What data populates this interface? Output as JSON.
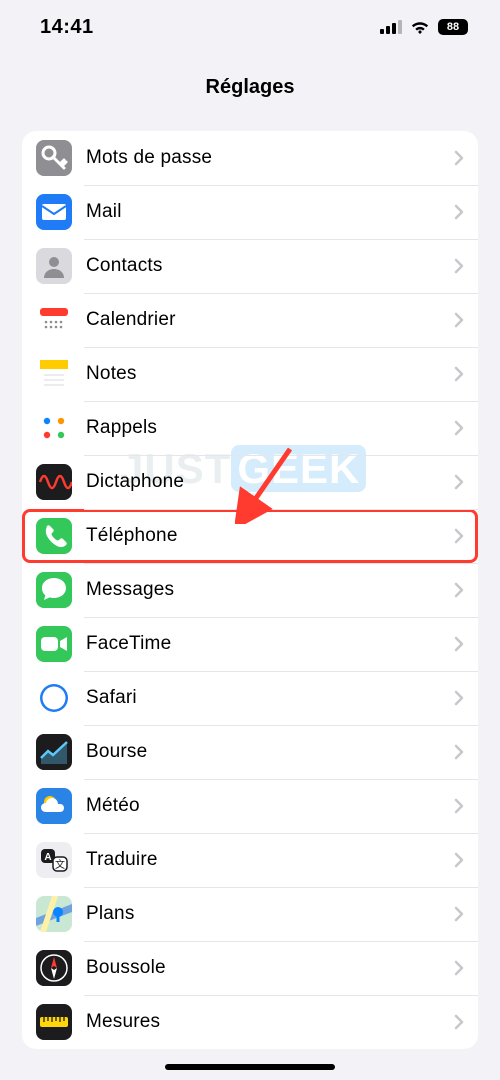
{
  "status": {
    "time": "14:41",
    "battery": "88"
  },
  "header": {
    "title": "Réglages"
  },
  "rows": [
    {
      "id": "passwords",
      "label": "Mots de passe",
      "icon": "key",
      "bg": "#8e8e93",
      "highlight": false
    },
    {
      "id": "mail",
      "label": "Mail",
      "icon": "mail",
      "bg": "#1f7cf6",
      "highlight": false
    },
    {
      "id": "contacts",
      "label": "Contacts",
      "icon": "contacts",
      "bg": "#d9d9de",
      "highlight": false
    },
    {
      "id": "calendar",
      "label": "Calendrier",
      "icon": "calendar",
      "bg": "#ffffff",
      "highlight": false
    },
    {
      "id": "notes",
      "label": "Notes",
      "icon": "notes",
      "bg": "#ffffff",
      "highlight": false
    },
    {
      "id": "reminders",
      "label": "Rappels",
      "icon": "reminders",
      "bg": "#ffffff",
      "highlight": false
    },
    {
      "id": "voicememos",
      "label": "Dictaphone",
      "icon": "voicememo",
      "bg": "#1c1c1e",
      "highlight": false
    },
    {
      "id": "phone",
      "label": "Téléphone",
      "icon": "phone",
      "bg": "#34c759",
      "highlight": true
    },
    {
      "id": "messages",
      "label": "Messages",
      "icon": "messages",
      "bg": "#34c759",
      "highlight": false
    },
    {
      "id": "facetime",
      "label": "FaceTime",
      "icon": "facetime",
      "bg": "#34c759",
      "highlight": false
    },
    {
      "id": "safari",
      "label": "Safari",
      "icon": "safari",
      "bg": "#ffffff",
      "highlight": false
    },
    {
      "id": "stocks",
      "label": "Bourse",
      "icon": "stocks",
      "bg": "#1c1c1e",
      "highlight": false
    },
    {
      "id": "weather",
      "label": "Météo",
      "icon": "weather",
      "bg": "#2a84e6",
      "highlight": false
    },
    {
      "id": "translate",
      "label": "Traduire",
      "icon": "translate",
      "bg": "#eeeef2",
      "highlight": false
    },
    {
      "id": "maps",
      "label": "Plans",
      "icon": "maps",
      "bg": "#e9f5ec",
      "highlight": false
    },
    {
      "id": "compass",
      "label": "Boussole",
      "icon": "compass",
      "bg": "#1c1c1e",
      "highlight": false
    },
    {
      "id": "measure",
      "label": "Mesures",
      "icon": "measure",
      "bg": "#1c1c1e",
      "highlight": false
    }
  ],
  "icon_names": {
    "key": "key-icon",
    "mail": "mail-icon",
    "contacts": "contacts-icon",
    "calendar": "calendar-icon",
    "notes": "notes-icon",
    "reminders": "reminders-icon",
    "voicememo": "voicememo-icon",
    "phone": "phone-icon",
    "messages": "messages-icon",
    "facetime": "facetime-icon",
    "safari": "safari-icon",
    "stocks": "stocks-icon",
    "weather": "weather-icon",
    "translate": "translate-icon",
    "maps": "maps-icon",
    "compass": "compass-icon",
    "measure": "measure-icon"
  },
  "annotation": {
    "highlight_color": "#ff3b30"
  },
  "watermark": {
    "just": "JUST",
    "geek": "GEEK"
  }
}
